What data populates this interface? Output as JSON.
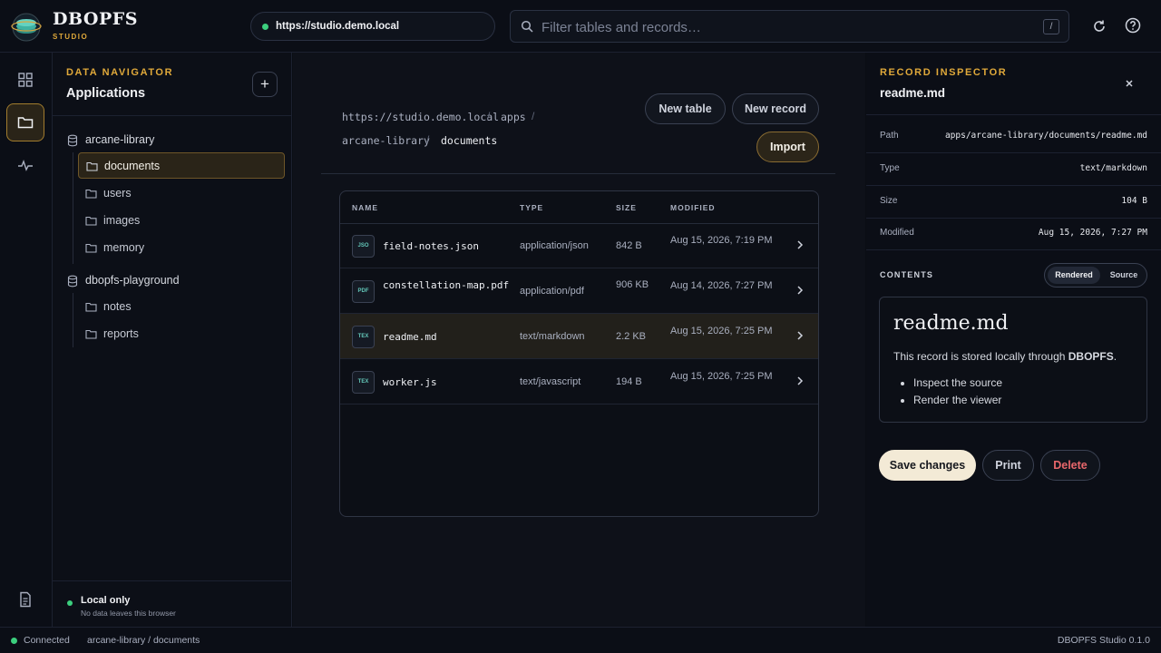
{
  "app": {
    "name": "DBOPFS",
    "subtitle": "STUDIO"
  },
  "topbar": {
    "url": "https://studio.demo.local",
    "search_placeholder": "Filter tables and records…",
    "search_shortcut": "/",
    "icons": [
      "refresh-icon",
      "help-icon"
    ]
  },
  "rail": {
    "items": [
      "grid-icon",
      "folder-icon",
      "activity-icon",
      "document-icon"
    ],
    "active": "folder-icon"
  },
  "navigator": {
    "kicker": "DATA NAVIGATOR",
    "title": "Applications",
    "add_label": "+",
    "groups": [
      {
        "name": "arcane-library",
        "items": [
          "documents",
          "users",
          "images",
          "memory"
        ]
      },
      {
        "name": "dbopfs-playground",
        "items": [
          "notes",
          "reports"
        ]
      }
    ],
    "selected": "documents",
    "footer": {
      "title": "Local only",
      "subtitle": "No data leaves this browser"
    }
  },
  "main": {
    "breadcrumb": [
      "https://studio.demo.local",
      "apps",
      "arcane-library",
      "documents"
    ],
    "actions": {
      "new_table": "New table",
      "new_record": "New record",
      "import": "Import"
    },
    "table": {
      "columns": [
        "NAME",
        "TYPE",
        "SIZE",
        "MODIFIED"
      ],
      "rows": [
        {
          "icon": "JSO",
          "name": "field-notes.json",
          "type": "application/json",
          "size": "842 B",
          "modified": "Aug 15, 2026, 7:19 PM"
        },
        {
          "icon": "PDF",
          "name": "constellation-map.pdf",
          "type": "application/pdf",
          "size": "906 KB",
          "modified": "Aug 14, 2026, 7:27 PM"
        },
        {
          "icon": "TEX",
          "name": "readme.md",
          "type": "text/markdown",
          "size": "2.2 KB",
          "modified": "Aug 15, 2026, 7:25 PM"
        },
        {
          "icon": "TEX",
          "name": "worker.js",
          "type": "text/javascript",
          "size": "194 B",
          "modified": "Aug 15, 2026, 7:25 PM"
        }
      ],
      "selected_row": 2
    }
  },
  "inspector": {
    "kicker": "RECORD INSPECTOR",
    "title": "readme.md",
    "meta": [
      {
        "key": "Path",
        "value": "apps/arcane-library/documents/readme.md"
      },
      {
        "key": "Type",
        "value": "text/markdown"
      },
      {
        "key": "Size",
        "value": "104 B"
      },
      {
        "key": "Modified",
        "value": "Aug 15, 2026, 7:27 PM"
      }
    ],
    "contents_label": "CONTENTS",
    "view_toggle": {
      "rendered": "Rendered",
      "source": "Source",
      "active": "Rendered"
    },
    "preview": {
      "heading": "readme.md",
      "para_prefix": "This record is stored locally through ",
      "para_bold": "DBOPFS",
      "para_suffix": ".",
      "bullets": [
        "Inspect the source",
        "Render the viewer"
      ]
    },
    "buttons": {
      "save": "Save changes",
      "print": "Print",
      "delete": "Delete"
    }
  },
  "statusbar": {
    "connection": "Connected",
    "location": "arcane-library / documents",
    "version": "DBOPFS Studio 0.1.0"
  },
  "colors": {
    "accent": "#e0a93a",
    "success": "#3ccf7e",
    "danger": "#e8676b",
    "background": "#0a0d14"
  }
}
